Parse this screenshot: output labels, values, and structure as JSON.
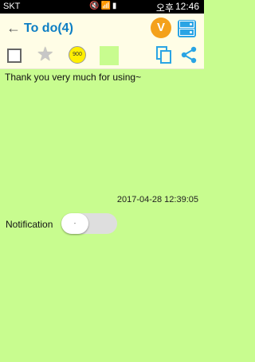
{
  "status_bar": {
    "carrier": "SKT",
    "ampm": "오후",
    "time": "12:46",
    "icons": [
      "mute-icon",
      "wifi-icon",
      "signal-icon",
      "battery-icon"
    ]
  },
  "header": {
    "back_icon": "arrow-left-icon",
    "title": "To do(4)",
    "badge_letter": "V",
    "menu_icon": "storage-icon",
    "colors": {
      "title": "#0d7ec4",
      "badge": "#f4a11b",
      "menu": "#2aa4e4"
    }
  },
  "toolbar": {
    "checkbox_checked": false,
    "star_icon": "star-icon",
    "coin_label": "900",
    "color_swatch": "#c8fc8f",
    "copy_icon": "copy-icon",
    "share_icon": "share-icon"
  },
  "note": {
    "text": "Thank you very much for using~",
    "datetime": "2017-04-28 12:39:05",
    "background": "#c8fc8f"
  },
  "notification": {
    "label": "Notification",
    "toggle_state": "off",
    "knob_text": "-"
  }
}
